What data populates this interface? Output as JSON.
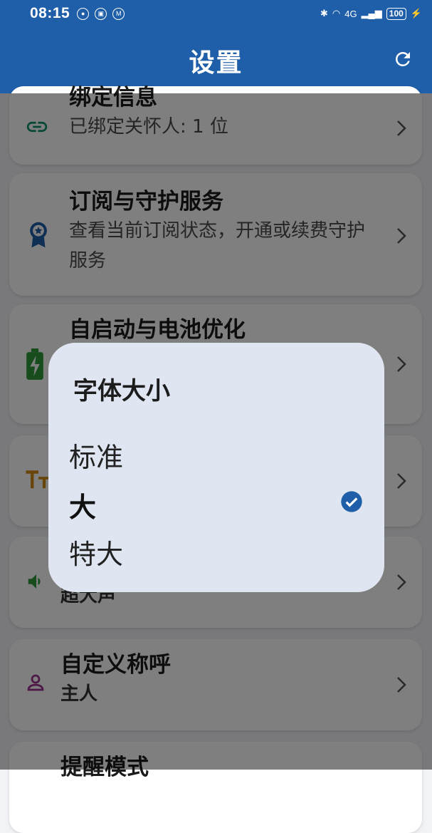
{
  "status": {
    "time": "08:15",
    "battery": "100",
    "net": "4G"
  },
  "appbar": {
    "title": "设置"
  },
  "cards": [
    {
      "title": "绑定信息",
      "subtitle": "已绑定关怀人: 1 位",
      "icon": "link-icon"
    },
    {
      "title": "订阅与守护服务",
      "subtitle": "查看当前订阅状态，开通或续费守护服务",
      "icon": "badge-icon"
    },
    {
      "title": "自启动与电池优化",
      "subtitle": "",
      "icon": "battery-icon"
    },
    {
      "title": "",
      "subtitle": "",
      "icon": "font-size-icon"
    },
    {
      "title": "",
      "subtitle": "超大声",
      "icon": "volume-icon"
    },
    {
      "title": "自定义称呼",
      "subtitle": "主人",
      "icon": "person-icon"
    },
    {
      "title": "提醒模式",
      "subtitle": "",
      "icon": ""
    }
  ],
  "dialog": {
    "title": "字体大小",
    "options": [
      "标准",
      "大",
      "特大"
    ],
    "selected": "大"
  }
}
